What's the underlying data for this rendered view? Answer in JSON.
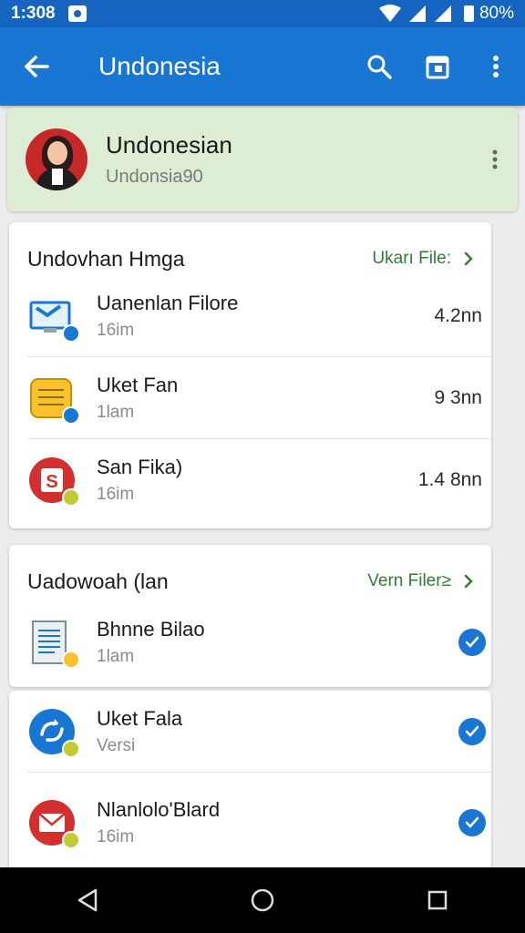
{
  "status": {
    "time": "1:308",
    "battery": "80%"
  },
  "appbar": {
    "title": "Undonesia"
  },
  "profile": {
    "name": "Undonesian",
    "subtitle": "Undonsia90"
  },
  "section1": {
    "title": "Undovhan Hmga",
    "link": "Ukarı File:",
    "items": [
      {
        "name": "Uanenlan Filore",
        "sub": "16im",
        "size": "4.2nn"
      },
      {
        "name": "Uket Fan",
        "sub": "1lam",
        "size": "9 3nn"
      },
      {
        "name": "San Fika)",
        "sub": "16im",
        "size": "1.4 8nn"
      }
    ]
  },
  "section2": {
    "title": "Uadowoah (lan",
    "link": "Vern Filer≥",
    "items": [
      {
        "name": "Bhnne Bilao",
        "sub": "1lam"
      },
      {
        "name": "Uket Fala",
        "sub": "Versi"
      },
      {
        "name": "Nlanlolo'Blard",
        "sub": "16im"
      }
    ]
  },
  "colors": {
    "primary": "#1976d2",
    "statusbar": "#1565c0",
    "profile_bg": "#dcedd3",
    "link_green": "#2e7d32"
  }
}
